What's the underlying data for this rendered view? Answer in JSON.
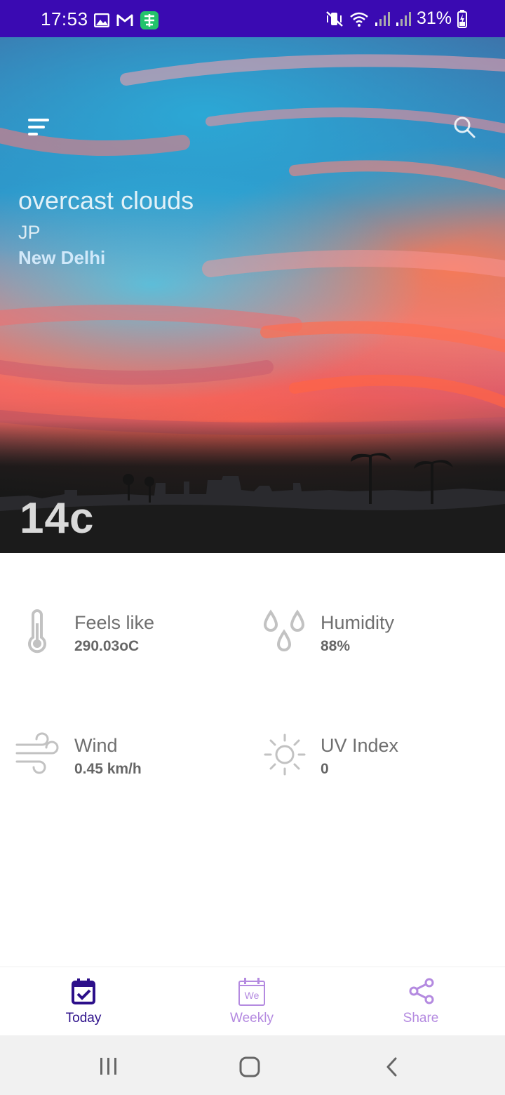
{
  "status_bar": {
    "time": "17:53",
    "battery_percent": "31%",
    "background_color": "#3a0ab2",
    "left_icons": [
      "image-icon",
      "gmail-icon",
      "app-notification-icon"
    ],
    "right_icons": [
      "mute-vibrate-icon",
      "wifi-icon",
      "signal-icon",
      "signal-icon",
      "battery-charging-icon"
    ]
  },
  "header": {
    "menu_icon": "menu-icon",
    "search_icon": "search-icon"
  },
  "weather": {
    "description": "overcast clouds",
    "country": "JP",
    "city": "New Delhi",
    "temperature": "14c"
  },
  "stats": [
    {
      "icon": "thermometer-icon",
      "label": "Feels like",
      "value": "290.03oC"
    },
    {
      "icon": "droplets-icon",
      "label": "Humidity",
      "value": "88%"
    },
    {
      "icon": "wind-icon",
      "label": "Wind",
      "value": "0.45 km/h"
    },
    {
      "icon": "sun-icon",
      "label": "UV Index",
      "value": "0"
    }
  ],
  "bottom_nav": {
    "items": [
      {
        "label": "Today",
        "icon": "calendar-check-icon",
        "active": true
      },
      {
        "label": "Weekly",
        "icon": "calendar-week-icon",
        "active": false,
        "icon_text": "We"
      },
      {
        "label": "Share",
        "icon": "share-icon",
        "active": false
      }
    ],
    "active_color": "#2c0f8a",
    "inactive_color": "#b48ae0"
  },
  "system_nav": {
    "buttons": [
      "recents-icon",
      "home-icon",
      "back-icon"
    ]
  }
}
